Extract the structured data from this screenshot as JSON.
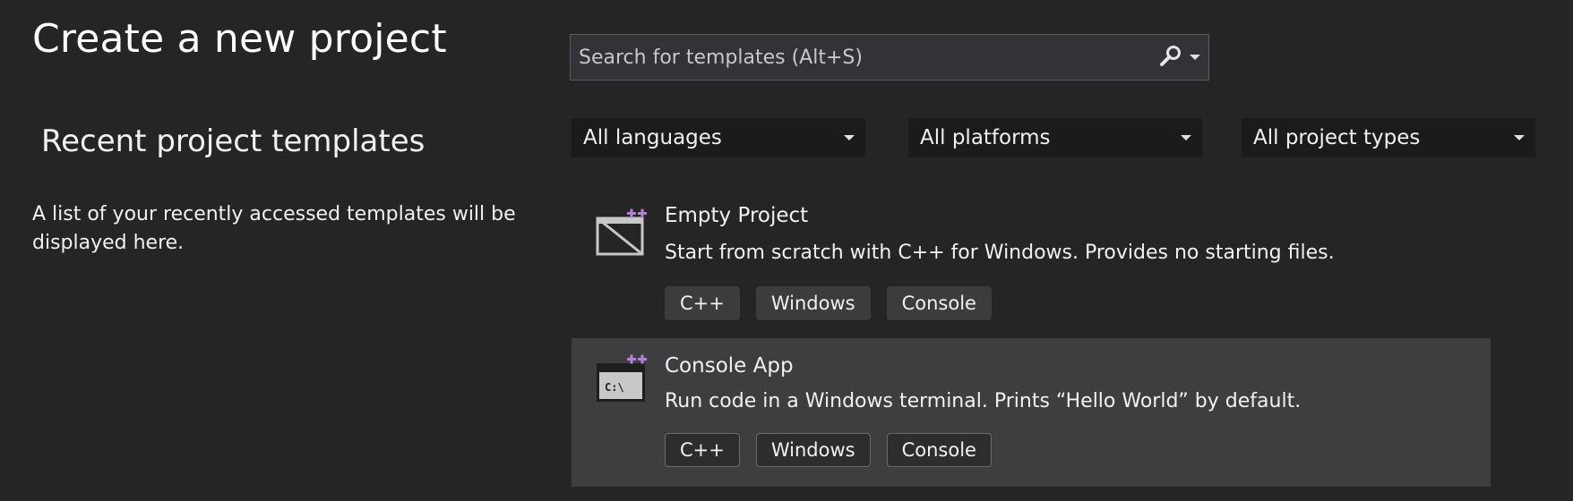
{
  "header": {
    "title": "Create a new project"
  },
  "recent": {
    "heading": "Recent project templates",
    "description": "A list of your recently accessed templates will be displayed here."
  },
  "search": {
    "placeholder": "Search for templates (Alt+S)",
    "value": "",
    "icon": "search-icon"
  },
  "filters": [
    {
      "label": "All languages"
    },
    {
      "label": "All platforms"
    },
    {
      "label": "All project types"
    }
  ],
  "templates": [
    {
      "title": "Empty Project",
      "description": "Start from scratch with C++ for Windows. Provides no starting files.",
      "icon": "empty-project-icon",
      "tags": [
        "C++",
        "Windows",
        "Console"
      ],
      "selected": false
    },
    {
      "title": "Console App",
      "description": "Run code in a Windows terminal. Prints “Hello World” by default.",
      "icon": "console-app-icon",
      "icon_text": "C:\\",
      "tags": [
        "C++",
        "Windows",
        "Console"
      ],
      "selected": true
    }
  ],
  "colors": {
    "background": "#252526",
    "filter_bg": "#1b1b1c",
    "selected_bg": "#3e3e40",
    "cpp_accent": "#b180d7"
  }
}
